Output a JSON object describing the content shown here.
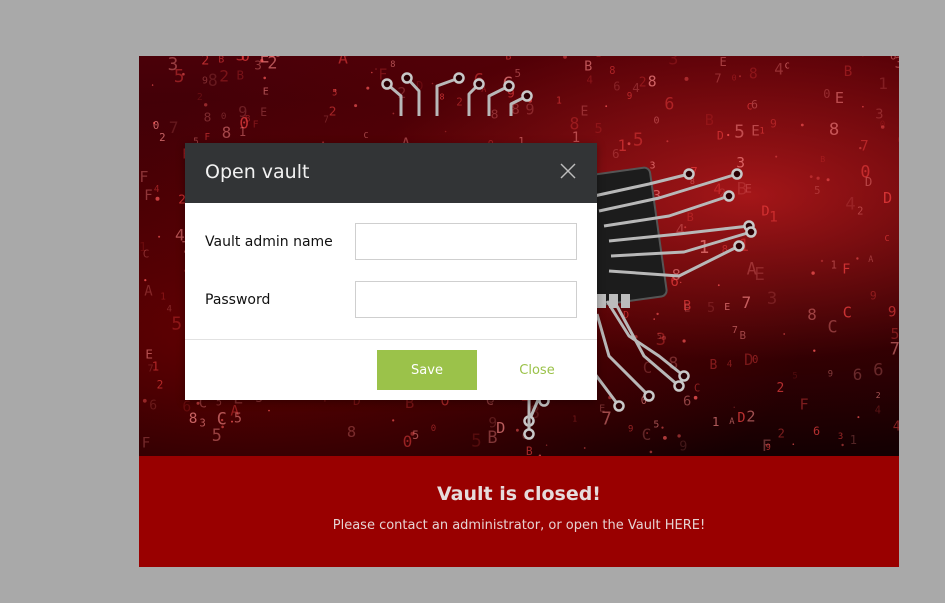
{
  "modal": {
    "title": "Open vault",
    "close_icon": "close-icon",
    "fields": [
      {
        "label": "Vault admin name",
        "value": "",
        "placeholder": ""
      },
      {
        "label": "Password",
        "value": "",
        "placeholder": ""
      }
    ],
    "save_label": "Save",
    "close_label": "Close"
  },
  "banner": {
    "title": "Vault is closed!",
    "text": "Please contact an administrator, or open the Vault HERE!"
  },
  "hero": {
    "image": "circuit-board-chip-illustration"
  },
  "colors": {
    "page_background": "#a9a9a9",
    "banner_background": "#990000",
    "modal_header": "#323436",
    "accent_green": "#9bc24a"
  }
}
